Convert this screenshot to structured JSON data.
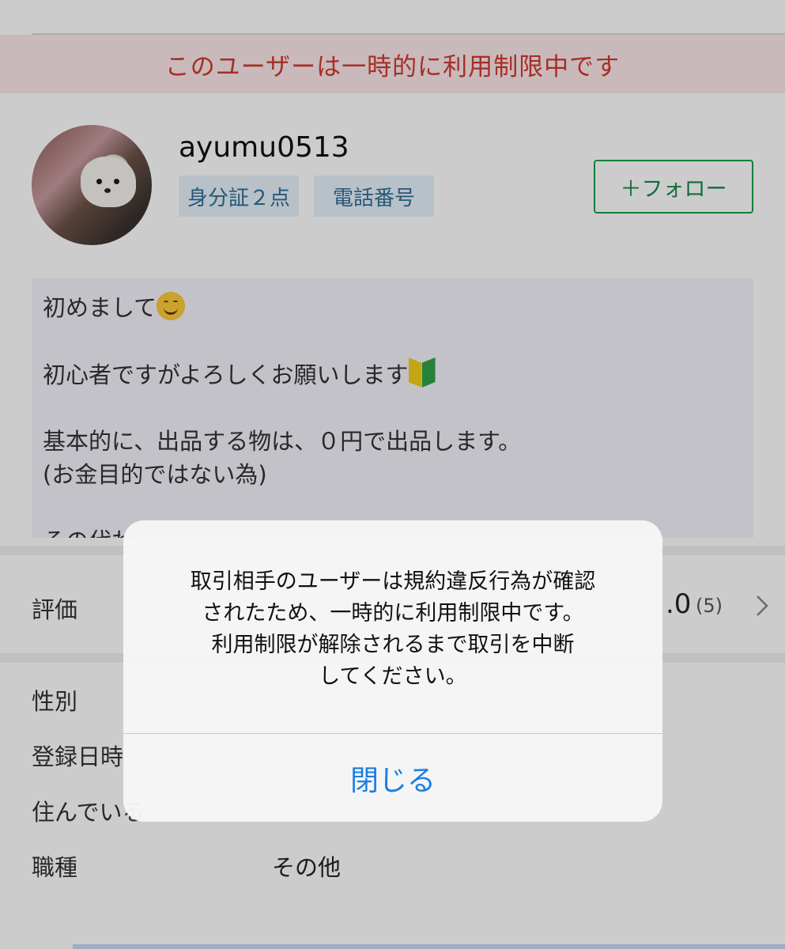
{
  "banner": {
    "text": "このユーザーは一時的に利用制限中です"
  },
  "profile": {
    "username": "ayumu0513",
    "badges": [
      "身分証２点",
      "電話番号"
    ],
    "follow_label": "＋フォロー"
  },
  "bio": {
    "line1": "初めまして",
    "line2": "初心者ですがよろしくお願いします",
    "line3": "基本的に、出品する物は、０円で出品します。",
    "line4": "(お金目的ではない為)",
    "line5": "その代わ"
  },
  "rating": {
    "label": "評価",
    "score_visible": ".0",
    "count": "(5)"
  },
  "details": [
    {
      "label": "性別",
      "value": ""
    },
    {
      "label": "登録日時",
      "value": ""
    },
    {
      "label": "住んでいる",
      "value": ""
    },
    {
      "label": "職種",
      "value": "その他"
    }
  ],
  "alert": {
    "message_lines": [
      "取引相手のユーザーは規約違反行為が確認",
      "されたため、一時的に利用制限中です。",
      "利用制限が解除されるまで取引を中断",
      "してください。"
    ],
    "close_label": "閉じる"
  },
  "colors": {
    "banner_text": "#d03a2f",
    "follow_green": "#18a149",
    "badge_bg": "#e6f1fb",
    "alert_button": "#1a7fe3"
  },
  "icons": [
    "smiling-face-emoji",
    "beginner-mark-emoji",
    "chevron-right-icon"
  ]
}
